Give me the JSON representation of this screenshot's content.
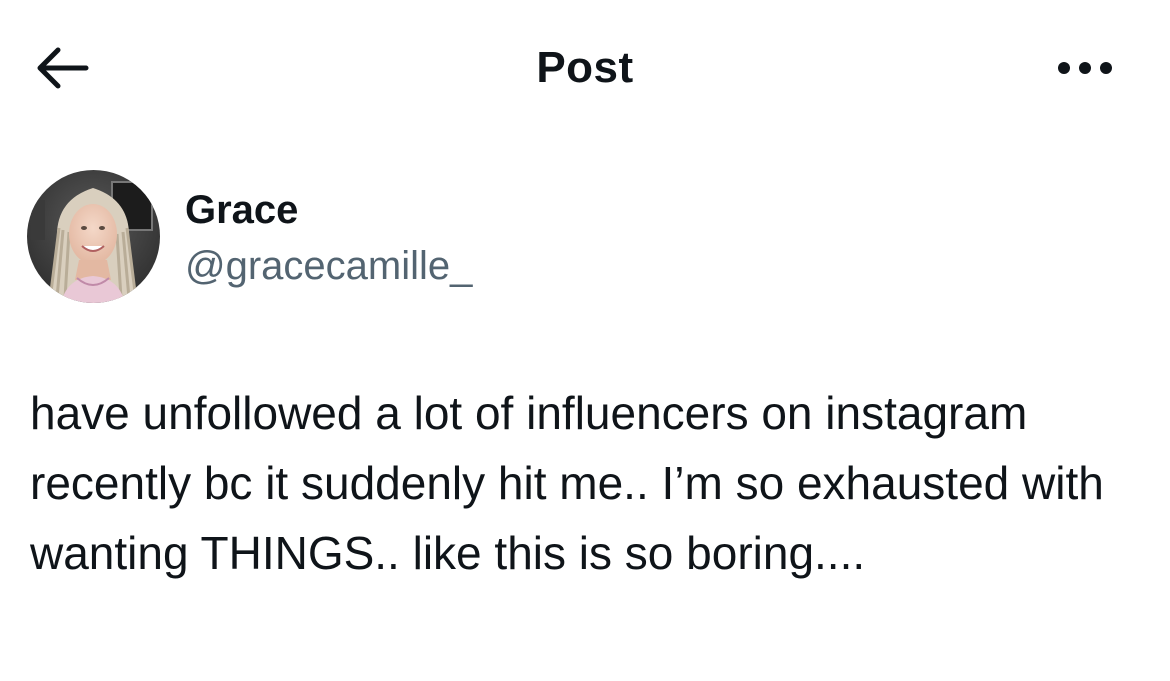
{
  "header": {
    "title": "Post",
    "back_icon": "arrow-left-icon",
    "more_icon": "more-horizontal-icon"
  },
  "author": {
    "display_name": "Grace",
    "handle": "@gracecamille_",
    "avatar_icon": "profile-photo"
  },
  "post": {
    "text": "have unfollowed a lot of influencers on instagram recently bc it suddenly hit me.. I’m so exhausted with wanting THINGS.. like this is so boring...."
  },
  "colors": {
    "text_primary": "#0f1419",
    "text_secondary": "#536471",
    "background": "#ffffff"
  }
}
